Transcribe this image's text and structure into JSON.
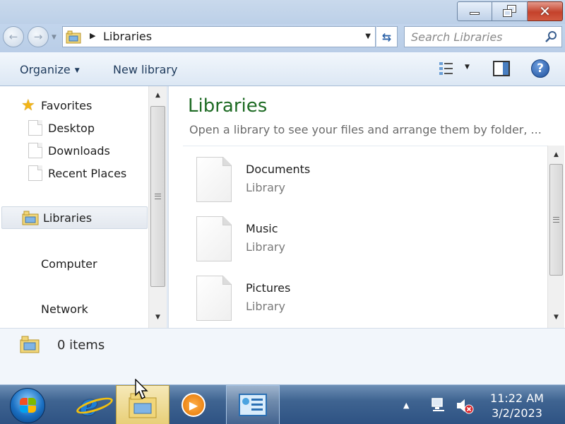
{
  "window": {
    "buttons": {
      "minimize": "minimize",
      "maximize": "restore",
      "close": "close"
    }
  },
  "address_bar": {
    "path": "Libraries",
    "search_placeholder": "Search Libraries"
  },
  "toolbar": {
    "organize_label": "Organize",
    "new_library_label": "New library"
  },
  "nav_pane": {
    "favorites_label": "Favorites",
    "favorites_items": [
      "Desktop",
      "Downloads",
      "Recent Places"
    ],
    "libraries_label": "Libraries",
    "computer_label": "Computer",
    "network_label": "Network"
  },
  "content": {
    "title": "Libraries",
    "description": "Open a library to see your files and arrange them by folder, ...",
    "libraries": [
      {
        "name": "Documents",
        "type": "Library"
      },
      {
        "name": "Music",
        "type": "Library"
      },
      {
        "name": "Pictures",
        "type": "Library"
      }
    ]
  },
  "details": {
    "item_count": "0 items"
  },
  "taskbar": {
    "time": "11:22 AM",
    "date": "3/2/2023"
  },
  "colors": {
    "title_green": "#1e6b24",
    "accent_blue": "#2d63a8",
    "close_red": "#c4412b",
    "taskbar_blue": "#3f6491"
  },
  "icons": [
    "back-icon",
    "forward-icon",
    "refresh-icon",
    "search-icon",
    "views-icon",
    "preview-pane-icon",
    "help-icon",
    "star-icon",
    "library-icon",
    "start-orb-icon",
    "internet-explorer-icon",
    "explorer-icon",
    "media-player-icon",
    "network-icon",
    "volume-muted-icon"
  ]
}
